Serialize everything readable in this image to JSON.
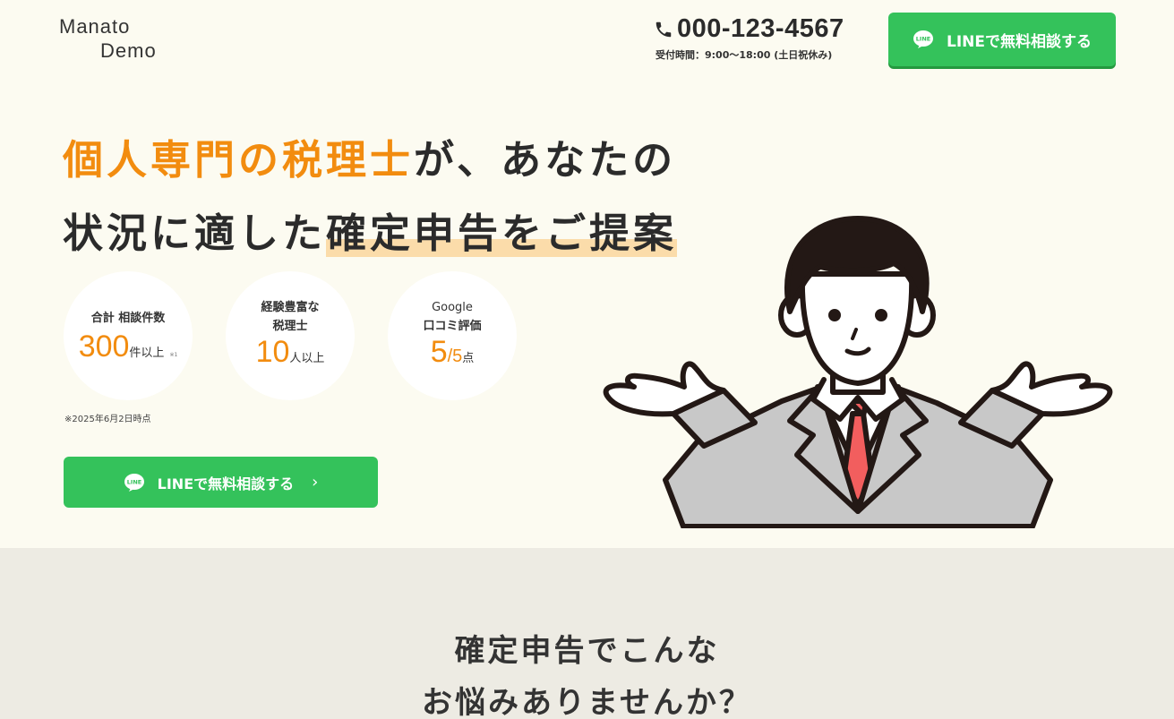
{
  "header": {
    "logo_line1": "Manato",
    "logo_line2": "Demo",
    "tel_number": "000-123-4567",
    "tel_hours": "受付時間：9:00〜18:00 (土日祝休み)",
    "line_button_label": "LINEで無料相談する",
    "icons": [
      "phone-icon",
      "line-logo-icon"
    ]
  },
  "hero": {
    "title_part1": "個人専門の税理士",
    "title_part2": "が、あなたの",
    "title_part3": "状況に適した",
    "title_part4": "確定申告をご提案",
    "stats": [
      {
        "label_line1": "合計 相談件数",
        "label_line2": "",
        "value": "300",
        "unit": "件以上",
        "note": "※1"
      },
      {
        "label_line1": "経験豊富な",
        "label_line2": "税理士",
        "value": "10",
        "unit": "人以上",
        "note": ""
      },
      {
        "label_line1": "Google",
        "label_line2": "口コミ評価",
        "value": "5",
        "value_suffix": "/5",
        "unit": "点",
        "note": ""
      }
    ],
    "stat_note": "※2025年6月2日時点",
    "cta_label": "LINEで無料相談する",
    "cta_chevron": "›"
  },
  "section2": {
    "title_line1": "確定申告でこんな",
    "title_line2": "お悩みありませんか？"
  },
  "colors": {
    "accent_orange": "#f28c0f",
    "line_green": "#34c25b",
    "highlight": "#fbdcaa",
    "background": "#fcfbf1",
    "section_bg": "#edebe3"
  }
}
